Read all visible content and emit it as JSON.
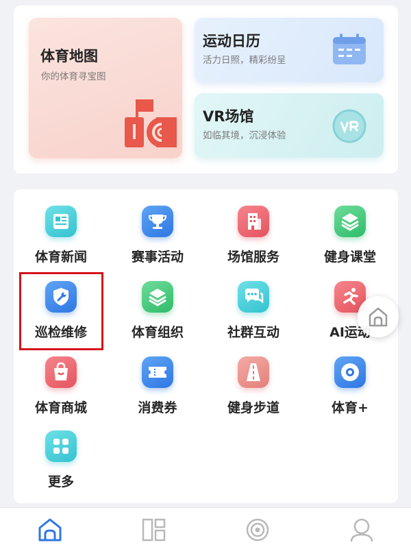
{
  "feature_tiles": {
    "map": {
      "title": "体育地图",
      "subtitle": "你的体育寻宝图",
      "icon": "map-flag-icon"
    },
    "calendar": {
      "title": "运动日历",
      "subtitle": "活力日照，精彩纷呈",
      "icon": "calendar-icon"
    },
    "vr": {
      "title": "VR场馆",
      "subtitle": "如临其境，沉浸体验",
      "icon": "vr-icon"
    }
  },
  "services": [
    {
      "label": "体育新闻",
      "icon": "newspaper-icon",
      "color": "#34c3d0"
    },
    {
      "label": "赛事活动",
      "icon": "trophy-icon",
      "color": "#2f77e3"
    },
    {
      "label": "场馆服务",
      "icon": "building-icon",
      "color": "#e5545e"
    },
    {
      "label": "健身课堂",
      "icon": "layers-icon",
      "color": "#2fbc6a"
    },
    {
      "label": "巡检维修",
      "icon": "wrench-shield-icon",
      "color": "#2f77e3",
      "highlighted": true
    },
    {
      "label": "体育组织",
      "icon": "layers-icon",
      "color": "#2fbc6a"
    },
    {
      "label": "社群互动",
      "icon": "chat-bubbles-icon",
      "color": "#34c3d0"
    },
    {
      "label": "AI运动",
      "icon": "runner-icon",
      "color": "#e5545e"
    },
    {
      "label": "体育商城",
      "icon": "shopping-bag-icon",
      "color": "#e5545e"
    },
    {
      "label": "消费券",
      "icon": "ticket-icon",
      "color": "#2f77e3"
    },
    {
      "label": "健身步道",
      "icon": "road-icon",
      "color": "#e4807a"
    },
    {
      "label": "体育+",
      "icon": "disc-icon",
      "color": "#2f77e3"
    },
    {
      "label": "更多",
      "icon": "grid-icon",
      "color": "#34c3d0"
    }
  ],
  "floating_button": {
    "icon": "home-icon"
  },
  "tabbar": [
    {
      "name": "home",
      "icon": "home-icon",
      "active": true,
      "active_color": "#2f77e3"
    },
    {
      "name": "dashboard",
      "icon": "dashboard-icon",
      "active": false
    },
    {
      "name": "target",
      "icon": "target-icon",
      "active": false
    },
    {
      "name": "profile",
      "icon": "user-icon",
      "active": false
    }
  ],
  "colors": {
    "highlight_border": "#d4131b",
    "inactive_tab": "#b8b8b8"
  }
}
